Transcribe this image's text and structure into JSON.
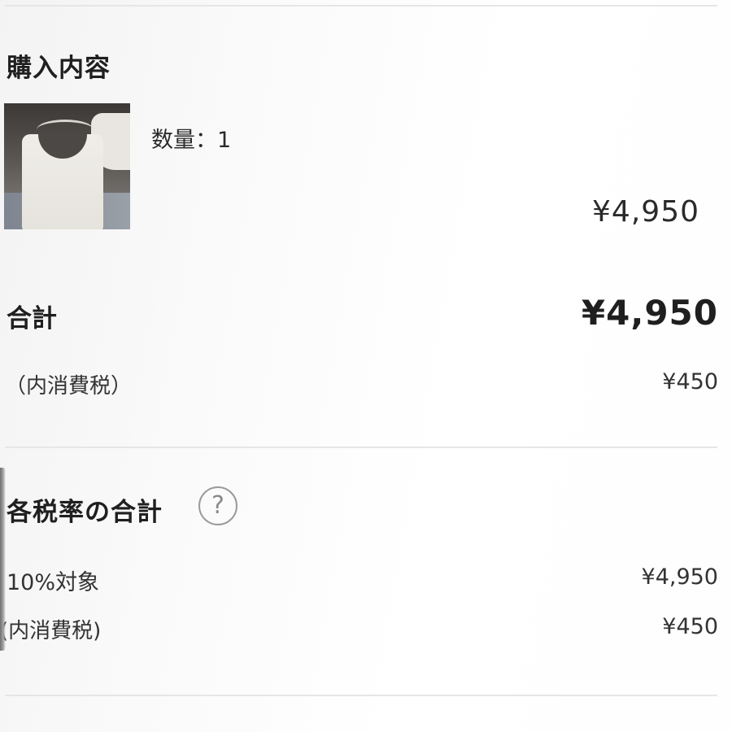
{
  "purchase": {
    "title": "購入内容",
    "item": {
      "image_alt": "白いタンクトップ",
      "quantity_text": "数量：1",
      "price": "¥4,950"
    }
  },
  "totals": {
    "label": "合計",
    "value": "¥4,950",
    "tax_label": "（内消費税）",
    "tax_value": "¥450"
  },
  "tax_rates": {
    "title": "各税率の合計",
    "help_glyph": "?",
    "rate_label": "10%対象",
    "rate_value": "¥4,950",
    "tax_label": "(内消費税)",
    "tax_value": "¥450"
  }
}
